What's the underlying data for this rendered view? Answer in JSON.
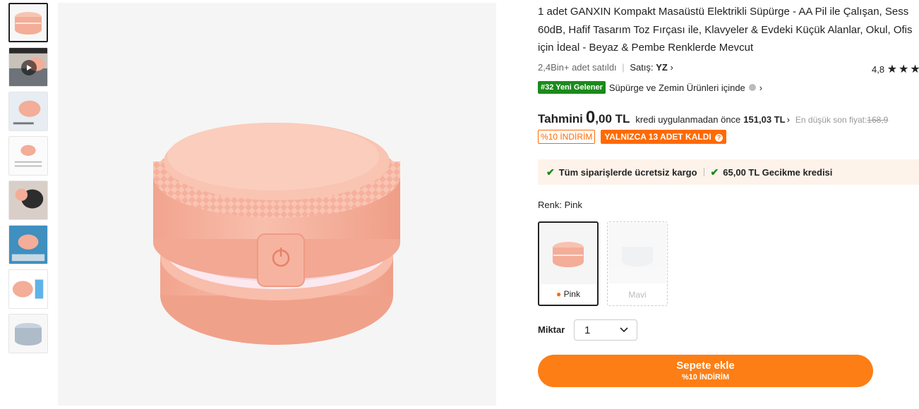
{
  "product": {
    "title_lines": [
      "1 adet GANXIN Kompakt Masaüstü Elektrikli Süpürge - AA Pil ile Çalışan, Sess",
      "60dB, Hafif Tasarım Toz Fırçası ile, Klavyeler & Evdeki Küçük Alanlar, Okul, Ofis",
      "için İdeal - Beyaz & Pembe Renklerde Mevcut"
    ],
    "sold": "2,4Bin+ adet satıldı",
    "seller_label": "Satış:",
    "seller_name": "YZ",
    "rating": "4,8"
  },
  "rank": {
    "badge": "#32 Yeni Gelener",
    "category": "Süpürge ve Zemin Ürünleri içinde"
  },
  "price": {
    "label": "Tahmini",
    "int": "0",
    "dec": ",00 TL",
    "note": "kredi uygulanmadan önce",
    "before": "151,03 TL",
    "lowest_label": "En düşük son fiyat:",
    "lowest_value": "168,9"
  },
  "tags": {
    "discount": "%10 İNDİRİM",
    "stock": "YALNIZCA 13 ADET KALDI"
  },
  "shipping": {
    "free": "Tüm siparişlerde ücretsiz kargo",
    "credit": "65,00 TL Gecikme kredisi"
  },
  "color": {
    "label": "Renk: Pink",
    "options": [
      {
        "name": "Pink",
        "selected": true
      },
      {
        "name": "Mavi",
        "selected": false
      }
    ]
  },
  "quantity": {
    "label": "Miktar",
    "value": "1"
  },
  "cart": {
    "label": "Sepete ekle",
    "sub": "%10 İNDİRİM"
  },
  "colors": {
    "accent": "#fd7e14",
    "badge_green": "#1a8a1a",
    "pink": "#f6b5a0"
  },
  "icons": [
    "play-icon",
    "chevron-right-icon",
    "info-icon",
    "check-icon",
    "chevron-down-icon",
    "star-icon",
    "flame-icon",
    "question-icon"
  ]
}
